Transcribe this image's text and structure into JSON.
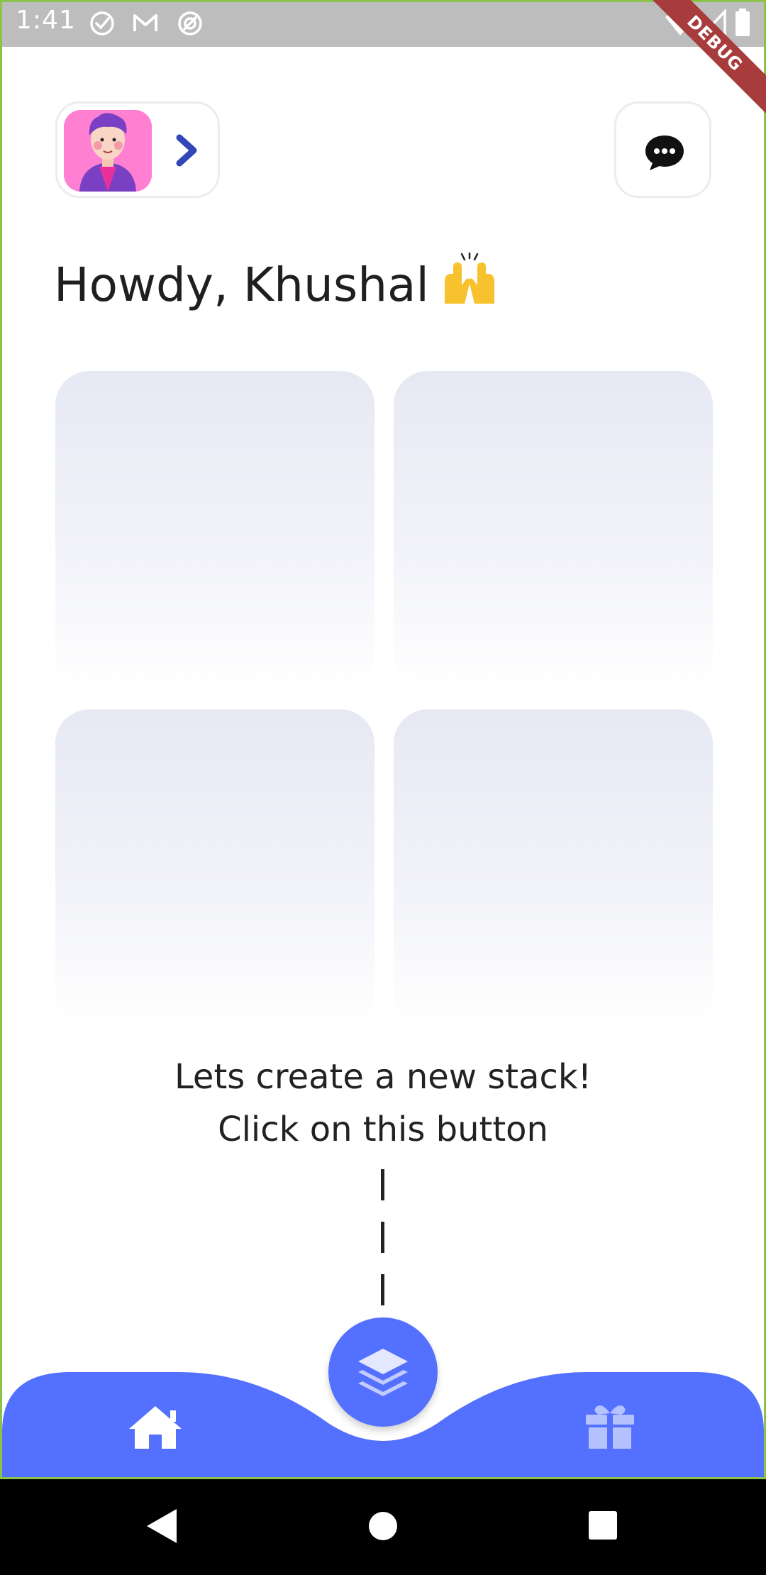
{
  "status_bar": {
    "time": "1:41",
    "left_icons": [
      "check-circle-icon",
      "gmail-icon",
      "data-saver-icon"
    ],
    "right_icons": [
      "wifi-icon",
      "signal-icon",
      "battery-icon"
    ]
  },
  "debug_banner": {
    "label": "DEBUG"
  },
  "header": {
    "profile": {
      "avatar": "avatar-illustration",
      "chevron": "chevron-right-icon"
    },
    "chat_button": {
      "icon": "chat-bubble-icon"
    }
  },
  "greeting": {
    "text": "Howdy, Khushal",
    "emoji": "raising-hands-emoji"
  },
  "stack_cards": [
    {},
    {},
    {},
    {}
  ],
  "empty_state": {
    "line1": "Lets create a new stack!",
    "line2": "Click on this button",
    "dashes": [
      "|",
      "|",
      "|"
    ]
  },
  "bottom_nav": {
    "items": [
      {
        "icon": "home-icon"
      },
      {
        "icon": "layers-icon"
      },
      {
        "icon": "gift-icon"
      }
    ]
  },
  "system_nav": {
    "buttons": [
      "back-icon",
      "home-circle-icon",
      "recents-icon"
    ]
  },
  "colors": {
    "accent": "#5470ff",
    "status_bar": "#bdbdbd",
    "card_top": "#e6e8f4",
    "chevron": "#3346b8",
    "avatar_bg": "#ff7fd3",
    "frame": "#8bc34a",
    "debug": "#a83b3b"
  }
}
